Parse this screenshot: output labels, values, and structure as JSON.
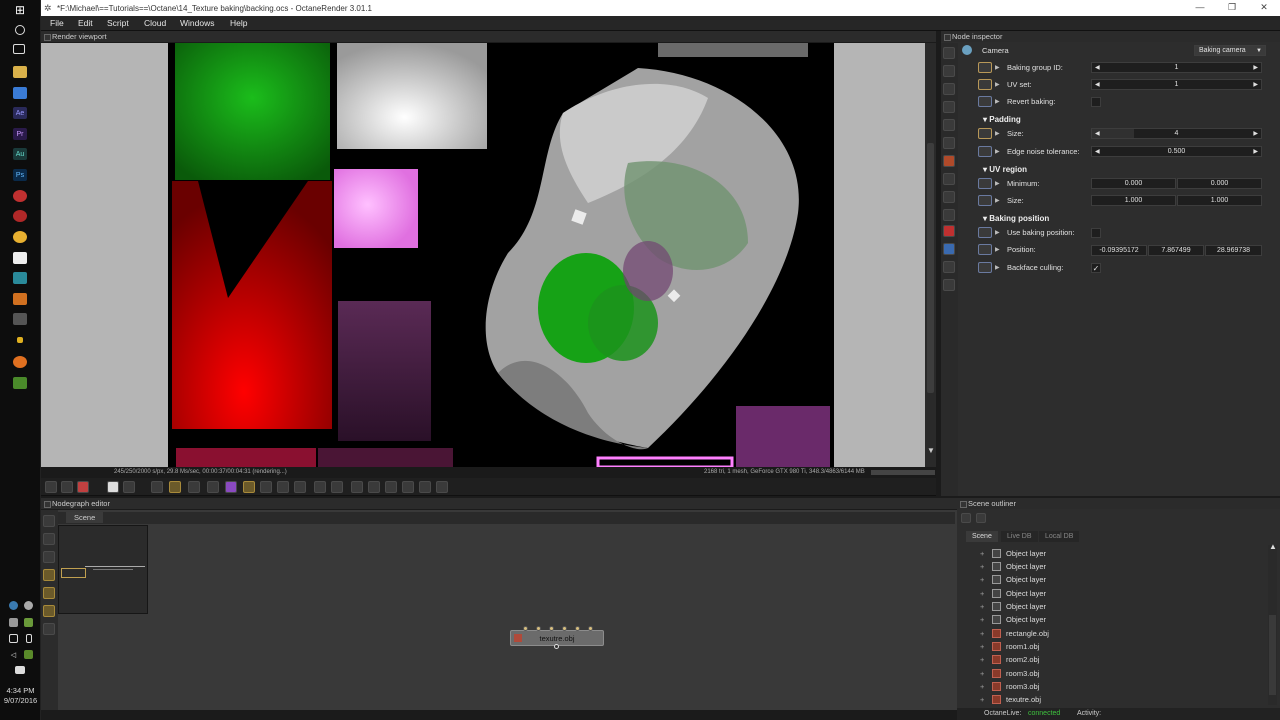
{
  "window": {
    "title": "*F:\\Michael\\==Tutorials==\\Octane\\14_Texture baking\\backing.ocs - OctaneRender 3.01.1"
  },
  "menu": [
    "File",
    "Edit",
    "Script",
    "Cloud",
    "Windows",
    "Help"
  ],
  "viewport": {
    "label": "Render viewport",
    "status_left": "245/250/2000 s/px, 29.8 Ms/sec, 00:00:37/00:04:31 (rendering...)",
    "status_right": "2168 tri, 1 mesh, GeForce GTX 980 Ti, 348.3/4863/6144 MB"
  },
  "nodegraph": {
    "label": "Nodegraph editor",
    "tab": "Scene",
    "node_label": "texutre.obj"
  },
  "inspector": {
    "label": "Node inspector",
    "camera": {
      "label": "Camera",
      "value": "Baking camera"
    },
    "rows": {
      "baking_group": {
        "label": "Baking group ID:",
        "value": "1"
      },
      "uv_set": {
        "label": "UV set:",
        "value": "1"
      },
      "revert": {
        "label": "Revert baking:"
      },
      "padding_section": "Padding",
      "size": {
        "label": "Size:",
        "value": "4"
      },
      "edge": {
        "label": "Edge noise tolerance:",
        "value": "0.500"
      },
      "uv_section": "UV region",
      "minimum": {
        "label": "Minimum:",
        "v1": "0.000",
        "v2": "0.000"
      },
      "uvsize": {
        "label": "Size:",
        "v1": "1.000",
        "v2": "1.000"
      },
      "pos_section": "Baking position",
      "use_pos": {
        "label": "Use baking position:"
      },
      "position": {
        "label": "Position:",
        "v1": "-0.09395172",
        "v2": "7.867499",
        "v3": "28.969738"
      },
      "backface": {
        "label": "Backface culling:",
        "check": "✓"
      }
    }
  },
  "outliner": {
    "label": "Scene outliner",
    "tabs": [
      "Scene",
      "Live DB",
      "Local DB"
    ],
    "items": [
      "Object layer",
      "Object layer",
      "Object layer",
      "Object layer",
      "Object layer",
      "Object layer",
      "rectangle.obj",
      "room1.obj",
      "room2.obj",
      "room3.obj",
      "room3.obj",
      "texutre.obj"
    ],
    "footer": {
      "live_label": "OctaneLive:",
      "live_status": "connected",
      "activity": "Activity:"
    }
  },
  "tray": {
    "time": "4:34 PM",
    "date": "9/07/2016"
  },
  "colors": {
    "accent": "#b89858",
    "connected": "#3ec13e"
  }
}
